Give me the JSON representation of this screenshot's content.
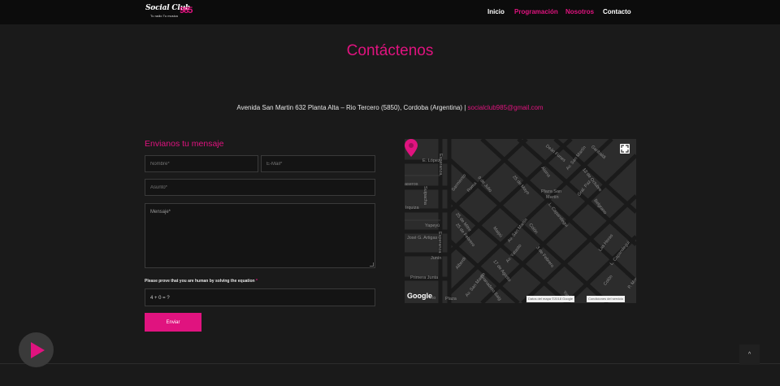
{
  "header": {
    "logo": {
      "title": "Social Club",
      "subtitle": "Tu radio Tu musica",
      "number": "985"
    },
    "nav": [
      {
        "label": "Inicio"
      },
      {
        "label": "Programación"
      },
      {
        "label": "Nosotros"
      },
      {
        "label": "Contacto"
      }
    ]
  },
  "main": {
    "title": "Contáctenos",
    "address": "Avenida San Martin 632 Planta Alta – Rio Tercero (5850), Cordoba (Argentina) | ",
    "email": "socialclub985@gmail.com"
  },
  "form": {
    "title": "Envianos tu mensaje",
    "name_placeholder": "Nombre*",
    "email_placeholder": "E-Mail*",
    "subject_placeholder": "Asunto*",
    "message_placeholder": "Mensaje*",
    "captcha_label": "Please prove that you are human by solving the equation",
    "captcha_required": "*",
    "captcha_equation": "4 + 0 = ?",
    "send_label": "Enviar"
  },
  "map": {
    "labels": {
      "dean_funes": "Deán Funes",
      "san_martin_top": "Av. San Martín",
      "garibaldi": "Garibaldi",
      "lopez": "E. López",
      "esperanza_top": "Esperanza",
      "alsina": "Alsina",
      "octubre": "12 de Octubre",
      "paz": "Gral. Paz",
      "sarmiento": "Sarmiento",
      "roma": "Roma",
      "julio": "9 de Julio",
      "mayo": "25 de Mayo",
      "plaza_sm": "Plaza San",
      "plaza_sm2": "Martín",
      "caseros": "aseros",
      "suipacha": "Suipacha",
      "irquiza": "Irquiza",
      "capandegui": "L. Capandegui",
      "belgrano": "Belgrano",
      "yapeyu": "Yapeyú",
      "mitre": "25 de Mitre",
      "maipu": "Maipú",
      "san_martin_mid": "Av. San Martín",
      "colon_mid": "Colón",
      "artigas": "José G. Artigas",
      "febrero": "25 de Febrero",
      "esperanza_bot": "Esperanza",
      "las_heras": "Las Heras",
      "capandegui2": "L. Capandegui",
      "junin": "Junín",
      "alberdi": "Alberdi",
      "yatasto": "Av. Yatasto",
      "febrero3": "3 de Febrero",
      "primera_junta": "Primera Junta",
      "agosto": "17 de Agosto",
      "san_martin_bot": "Av. San Martín",
      "granadero": "Granadero Baig",
      "yat": "Yat",
      "colon_bot": "Colón",
      "pmoreno": "P. More",
      "plaza": "Plaza",
      "io": "io"
    },
    "google_logo": "Google",
    "data_notice": "Datos del mapa ©2018 Google",
    "terms": "Condiciones del servicio",
    "colors": {
      "background": "#2c2c2c",
      "roads": "#1a1a1a",
      "pin": "#e0137f"
    }
  },
  "controls": {
    "play_icon": "play-icon",
    "top_arrow": "^"
  },
  "colors": {
    "accent": "#e0137f",
    "background": "#1a1a1a",
    "header": "#0c0c0c"
  }
}
